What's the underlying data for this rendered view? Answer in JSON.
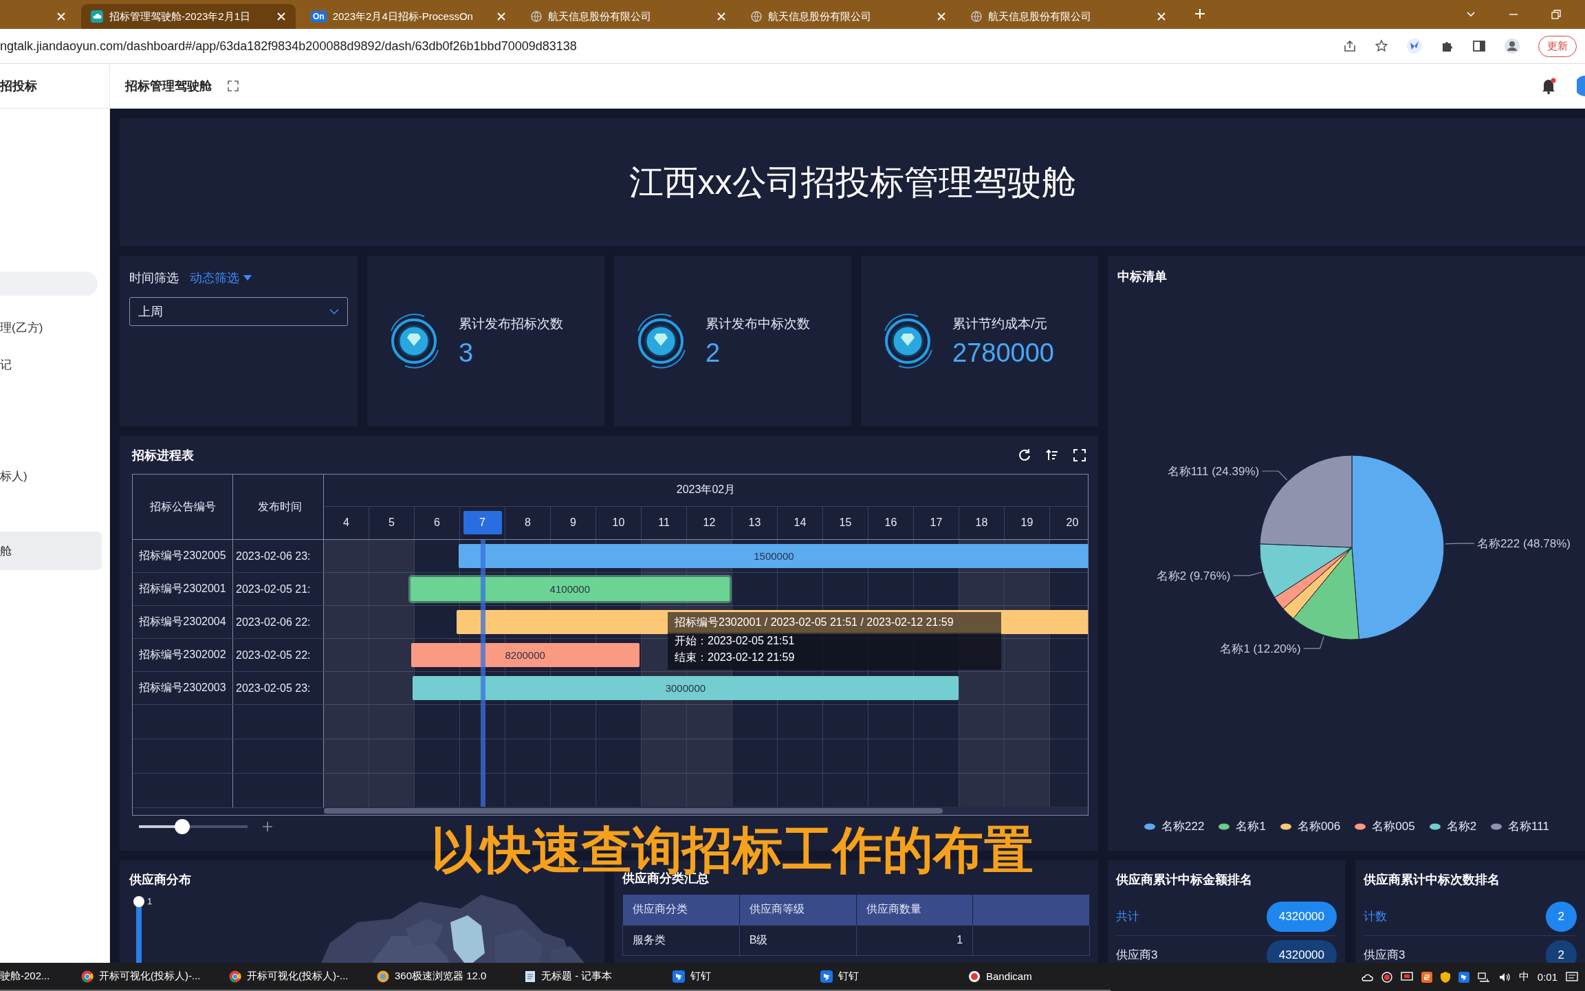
{
  "tabs": [
    {
      "kind": "none",
      "selected": false
    },
    {
      "kind": "app",
      "title": "招标管理驾驶舱-2023年2月1日",
      "selected": true
    },
    {
      "kind": "badge",
      "badge": "On",
      "title": "2023年2月4日招标-ProcessOn",
      "selected": false
    },
    {
      "kind": "globe",
      "title": "航天信息股份有限公司",
      "selected": false
    },
    {
      "kind": "globe",
      "title": "航天信息股份有限公司",
      "selected": false
    },
    {
      "kind": "globe",
      "title": "航天信息股份有限公司",
      "selected": false
    }
  ],
  "address_bar": {
    "url": "ngtalk.jiandaoyun.com/dashboard#/app/63da182f9834b200088d9892/dash/63db0f26b1bbd70009d83138",
    "update_button": "更新"
  },
  "app_header": {
    "app_name": "招投标",
    "page_title": "招标管理驾驶舱"
  },
  "sidebar": {
    "items": [
      {
        "label": "理(乙方)",
        "selected": false
      },
      {
        "label": "记",
        "selected": false
      },
      {
        "label": "标人)",
        "selected": false
      },
      {
        "label": "舱",
        "selected": true
      }
    ]
  },
  "dashboard": {
    "title": "江西xx公司招投标管理驾驶舱",
    "filter": {
      "label": "时间筛选",
      "dynamic_filter": "动态筛选",
      "value": "上周"
    },
    "kpis": [
      {
        "label": "累计发布招标次数",
        "value": "3"
      },
      {
        "label": "累计发布中标次数",
        "value": "2"
      },
      {
        "label": "累计节约成本/元",
        "value": "2780000"
      }
    ],
    "gantt": {
      "title": "招标进程表",
      "columns": [
        "招标公告编号",
        "发布时间"
      ],
      "month": "2023年02月",
      "days": [
        {
          "label": "4",
          "weekend": true,
          "selected": false
        },
        {
          "label": "5",
          "weekend": true,
          "selected": false
        },
        {
          "label": "6",
          "weekend": false,
          "selected": false
        },
        {
          "label": "7",
          "weekend": false,
          "selected": true
        },
        {
          "label": "8",
          "weekend": false,
          "selected": false
        },
        {
          "label": "9",
          "weekend": false,
          "selected": false
        },
        {
          "label": "10",
          "weekend": false,
          "selected": false
        },
        {
          "label": "11",
          "weekend": true,
          "selected": false
        },
        {
          "label": "12",
          "weekend": true,
          "selected": false
        },
        {
          "label": "13",
          "weekend": false,
          "selected": false
        },
        {
          "label": "14",
          "weekend": false,
          "selected": false
        },
        {
          "label": "15",
          "weekend": false,
          "selected": false
        },
        {
          "label": "16",
          "weekend": false,
          "selected": false
        },
        {
          "label": "17",
          "weekend": false,
          "selected": false
        },
        {
          "label": "18",
          "weekend": true,
          "selected": false
        },
        {
          "label": "19",
          "weekend": true,
          "selected": false
        },
        {
          "label": "20",
          "weekend": false,
          "selected": false
        }
      ],
      "rows": [
        {
          "code": "招标编号2302005",
          "published": "2023-02-06 23:",
          "bar": {
            "label": "1500000",
            "color": "#5aabf0",
            "hovered": false
          }
        },
        {
          "code": "招标编号2302001",
          "published": "2023-02-05 21:",
          "bar": {
            "label": "4100000",
            "color": "#6bd494",
            "hovered": true
          }
        },
        {
          "code": "招标编号2302004",
          "published": "2023-02-06 22:",
          "bar": {
            "color": "#fdc876",
            "hovered": false
          }
        },
        {
          "code": "招标编号2302002",
          "published": "2023-02-05 22:",
          "bar": {
            "label": "8200000",
            "color": "#fb9a82",
            "hovered": false
          }
        },
        {
          "code": "招标编号2302003",
          "published": "2023-02-05 23:",
          "bar": {
            "label": "3000000",
            "color": "#74cdd0",
            "hovered": false
          }
        }
      ],
      "tooltip": {
        "title": "招标编号2302001 / 2023-02-05 21:51 / 2023-02-12 21:59",
        "lines": [
          "开始：2023-02-05 21:51",
          "结束：2023-02-12 21:59"
        ]
      },
      "zoom_slider": {
        "level": 0.4
      }
    },
    "pie": {
      "title": "中标清单",
      "chart_data": {
        "type": "pie",
        "categories": [
          "名称222",
          "名称1",
          "名称006",
          "名称005",
          "名称2",
          "名称111"
        ],
        "series": [
          {
            "values": [
              48.78,
              12.2,
              2.44,
              2.44,
              9.76,
              24.39
            ]
          }
        ]
      },
      "legend": [
        {
          "color": "#5aabf0"
        },
        {
          "color": "#6bcb8b"
        },
        {
          "color": "#fcc875"
        },
        {
          "color": "#fb9a82"
        },
        {
          "color": "#72cdd0"
        },
        {
          "color": "#8f93ae"
        }
      ],
      "slice_labels": [
        "名称111 (24.39%)",
        "名称222 (48.78%)",
        "名称2 (9.76%)",
        "名称1 (12.20%)"
      ]
    },
    "supplier_map": {
      "title": "供应商分布",
      "range": {
        "label": "1",
        "level": 1
      }
    },
    "supplier_summary": {
      "title": "供应商分类汇总",
      "columns": [
        "供应商分类",
        "供应商等级",
        "供应商数量"
      ],
      "rows": [
        [
          "服务类",
          "B级",
          "1"
        ]
      ]
    },
    "rankings": [
      {
        "title": "供应商累计中标金额排名",
        "rows": [
          {
            "kind": "total",
            "name": "共计",
            "value": "4320000"
          },
          {
            "kind": "item",
            "name": "供应商3",
            "value": "4320000"
          }
        ]
      },
      {
        "title": "供应商累计中标次数排名",
        "rows": [
          {
            "kind": "total",
            "name": "计数",
            "value": "2"
          },
          {
            "kind": "item",
            "name": "供应商3",
            "value": "2"
          }
        ]
      }
    ]
  },
  "subtitle": "以快速查询招标工作的布置",
  "taskbar": {
    "items": [
      {
        "kind": "plain",
        "label": "驶舱-202..."
      },
      {
        "kind": "chrome",
        "label": "开标可视化(投标人)-..."
      },
      {
        "kind": "chrome",
        "label": "开标可视化(投标人)-..."
      },
      {
        "kind": "browser360",
        "label": "360极速浏览器 12.0"
      },
      {
        "kind": "notepad",
        "label": "无标题 - 记事本"
      },
      {
        "kind": "dingtalk",
        "label": "钉钉"
      },
      {
        "kind": "dingtalk",
        "label": "钉钉"
      },
      {
        "kind": "recorder",
        "label": "Bandicam"
      }
    ],
    "ime": "中",
    "clock": "0:01"
  }
}
